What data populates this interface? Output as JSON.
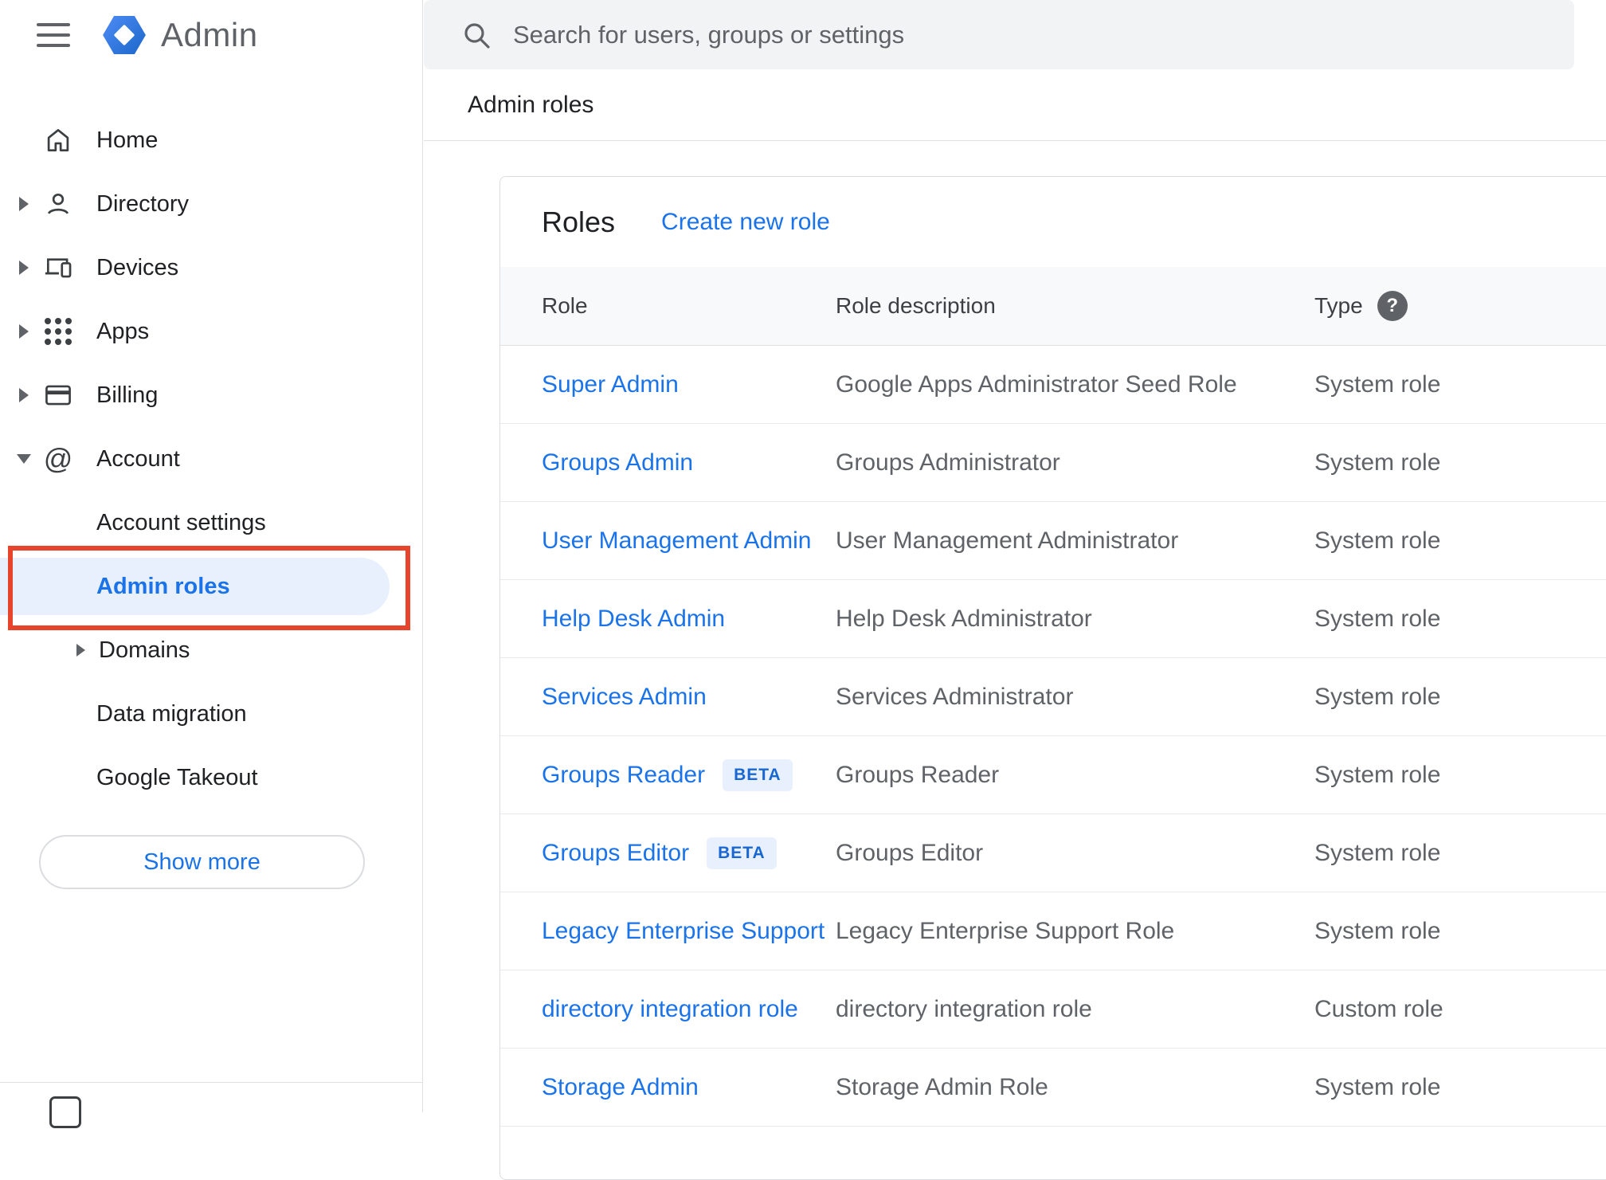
{
  "app": {
    "name": "Admin"
  },
  "search": {
    "placeholder": "Search for users, groups or settings"
  },
  "breadcrumb": {
    "label": "Admin roles"
  },
  "sidebar": {
    "items": [
      {
        "label": "Home"
      },
      {
        "label": "Directory"
      },
      {
        "label": "Devices"
      },
      {
        "label": "Apps"
      },
      {
        "label": "Billing"
      },
      {
        "label": "Account"
      }
    ],
    "account_children": [
      {
        "label": "Account settings"
      },
      {
        "label": "Admin roles",
        "active": true
      },
      {
        "label": "Domains"
      },
      {
        "label": "Data migration"
      },
      {
        "label": "Google Takeout"
      }
    ],
    "show_more_label": "Show more"
  },
  "roles": {
    "title": "Roles",
    "create_link": "Create new role",
    "columns": {
      "role": "Role",
      "description": "Role description",
      "type": "Type"
    },
    "beta_label": "BETA",
    "help_glyph": "?",
    "rows": [
      {
        "role": "Super Admin",
        "description": "Google Apps Administrator Seed Role",
        "type": "System role"
      },
      {
        "role": "Groups Admin",
        "description": "Groups Administrator",
        "type": "System role"
      },
      {
        "role": "User Management Admin",
        "description": "User Management Administrator",
        "type": "System role"
      },
      {
        "role": "Help Desk Admin",
        "description": "Help Desk Administrator",
        "type": "System role"
      },
      {
        "role": "Services Admin",
        "description": "Services Administrator",
        "type": "System role"
      },
      {
        "role": "Groups Reader",
        "beta": true,
        "description": "Groups Reader",
        "type": "System role"
      },
      {
        "role": "Groups Editor",
        "beta": true,
        "description": "Groups Editor",
        "type": "System role"
      },
      {
        "role": "Legacy Enterprise Support",
        "description": "Legacy Enterprise Support Role",
        "type": "System role"
      },
      {
        "role": "directory integration role",
        "description": "directory integration role",
        "type": "Custom role"
      },
      {
        "role": "Storage Admin",
        "description": "Storage Admin Role",
        "type": "System role"
      }
    ]
  },
  "colors": {
    "accent_blue": "#1a73e8",
    "active_item_bg": "#e8f0fe",
    "annotation_red": "#e8442c",
    "search_bg": "#f1f3f4",
    "table_header_bg": "#f8f9fa",
    "beta_bg": "#e8f0fe",
    "beta_text": "#1967d2"
  }
}
